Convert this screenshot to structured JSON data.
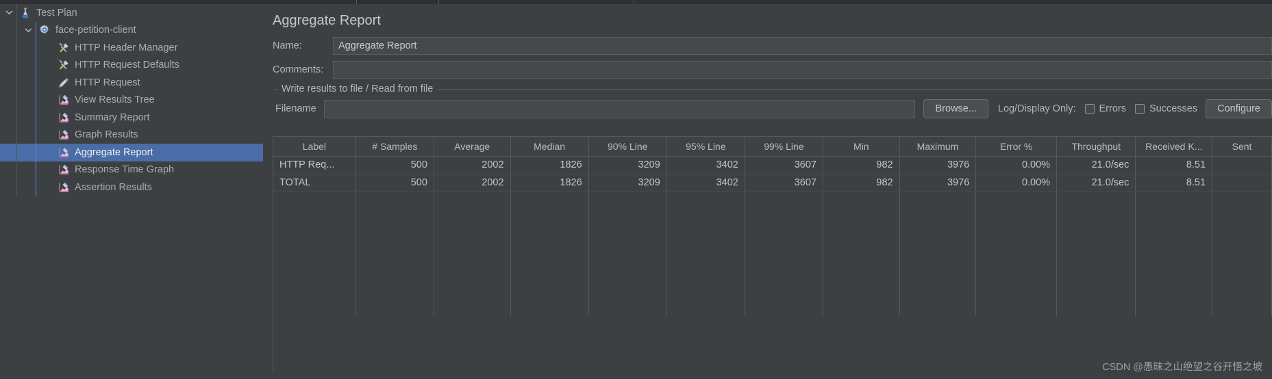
{
  "window": {
    "top_strip_seams": [
      520,
      640,
      925
    ]
  },
  "sidebar": {
    "tree": [
      {
        "label": "Test Plan",
        "depth": 0,
        "icon": "test-plan-icon",
        "twisty": "expanded",
        "selected": false
      },
      {
        "label": "face-petition-client",
        "depth": 1,
        "icon": "thread-group-icon",
        "twisty": "expanded",
        "selected": false
      },
      {
        "label": "HTTP Header Manager",
        "depth": 2,
        "icon": "config-element-icon",
        "twisty": "none",
        "selected": false
      },
      {
        "label": "HTTP Request Defaults",
        "depth": 2,
        "icon": "config-element-icon",
        "twisty": "none",
        "selected": false
      },
      {
        "label": "HTTP Request",
        "depth": 2,
        "icon": "sampler-icon",
        "twisty": "none",
        "selected": false
      },
      {
        "label": "View Results Tree",
        "depth": 2,
        "icon": "listener-icon",
        "twisty": "none",
        "selected": false
      },
      {
        "label": "Summary Report",
        "depth": 2,
        "icon": "listener-icon",
        "twisty": "none",
        "selected": false
      },
      {
        "label": "Graph Results",
        "depth": 2,
        "icon": "listener-icon",
        "twisty": "none",
        "selected": false
      },
      {
        "label": "Aggregate Report",
        "depth": 2,
        "icon": "listener-icon",
        "twisty": "none",
        "selected": true
      },
      {
        "label": "Response Time Graph",
        "depth": 2,
        "icon": "listener-icon",
        "twisty": "none",
        "selected": false
      },
      {
        "label": "Assertion Results",
        "depth": 2,
        "icon": "listener-icon",
        "twisty": "none",
        "selected": false
      }
    ]
  },
  "main": {
    "page_title": "Aggregate Report",
    "name_label": "Name:",
    "name_value": "Aggregate Report",
    "comments_label": "Comments:",
    "comments_value": "",
    "comments_placeholder": "",
    "groupbox_title": "Write results to file / Read from file",
    "filename_label": "Filename",
    "filename_value": "",
    "filename_placeholder": "",
    "browse_label": "Browse...",
    "logdisplay_label": "Log/Display Only:",
    "errors_label": "Errors",
    "errors_checked": false,
    "successes_label": "Successes",
    "successes_checked": false,
    "configure_label": "Configure"
  },
  "table": {
    "columns": [
      "Label",
      "# Samples",
      "Average",
      "Median",
      "90% Line",
      "95% Line",
      "99% Line",
      "Min",
      "Maximum",
      "Error %",
      "Throughput",
      "Received K...",
      "Sent"
    ],
    "rows": [
      [
        "HTTP Req...",
        "500",
        "2002",
        "1826",
        "3209",
        "3402",
        "3607",
        "982",
        "3976",
        "0.00%",
        "21.0/sec",
        "8.51",
        ""
      ],
      [
        "TOTAL",
        "500",
        "2002",
        "1826",
        "3209",
        "3402",
        "3607",
        "982",
        "3976",
        "0.00%",
        "21.0/sec",
        "8.51",
        ""
      ]
    ],
    "empty_filler_rows": 7
  },
  "watermark": {
    "text": "CSDN @愚昧之山绝望之谷开悟之坡"
  },
  "colors": {
    "background": "#3c4043",
    "selection": "#4a6da7",
    "text": "#b2b6b9",
    "border": "#55595c",
    "input_bg": "#46494c",
    "guide_blue": "#5b8fd6"
  }
}
